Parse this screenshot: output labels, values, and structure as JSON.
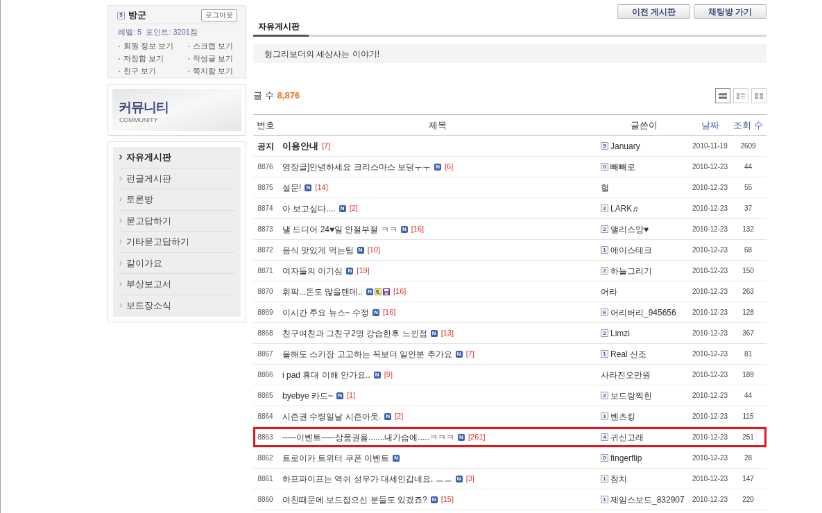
{
  "user_box": {
    "level": "5",
    "name": "방군",
    "logout_button": "로그아웃",
    "stats": "레벨: 5  포인트: 3201점",
    "links": [
      "회원 정보 보기",
      "스크랩 보기",
      "저장함 보기",
      "작성글 보기",
      "친구 보기",
      "쪽지함 보기"
    ]
  },
  "community_banner": {
    "title": "커뮤니티",
    "subtitle": "COMMUNITY"
  },
  "sidebar": {
    "items": [
      {
        "label": "자유게시판",
        "selected": true
      },
      {
        "label": "펀글게시판",
        "selected": false
      },
      {
        "label": "토론방",
        "selected": false
      },
      {
        "label": "묻고답하기",
        "selected": false
      },
      {
        "label": "기타묻고답하기",
        "selected": false
      },
      {
        "label": "같이가요",
        "selected": false
      },
      {
        "label": "부상보고서",
        "selected": false
      },
      {
        "label": "보드장소식",
        "selected": false
      }
    ]
  },
  "top_buttons": [
    "이전 게시판",
    "채팅방 가기"
  ],
  "tabs": [
    {
      "label": "자유게시판",
      "selected": true
    }
  ],
  "description": "헝그리보더의 세상사는 이야기!",
  "post_count": {
    "label": "글 수",
    "value": "8,876"
  },
  "view_modes": [
    {
      "kind": "list",
      "selected": true
    },
    {
      "kind": "summary",
      "selected": false
    },
    {
      "kind": "grid",
      "selected": false
    }
  ],
  "table": {
    "columns": [
      {
        "label": "번호",
        "sortable": false
      },
      {
        "label": "제목",
        "sortable": false
      },
      {
        "label": "글쓴이",
        "sortable": false
      },
      {
        "label": "날짜",
        "sortable": true
      },
      {
        "label": "조회 수",
        "sortable": true
      }
    ],
    "rows": [
      {
        "kind": "notice",
        "number": "공지",
        "subject": {
          "title": "이용안내",
          "comments": "[7]"
        },
        "writer": {
          "level": "5",
          "name": "January"
        },
        "date": "2010-11-19",
        "views": "2609",
        "highlighted": false
      },
      {
        "kind": "post",
        "number": "8876",
        "subject": {
          "title": "염장글]안녕하세요 크리스마스 보딩ㅜㅜ",
          "new_badge": "N",
          "comments": "[6]"
        },
        "writer": {
          "level": "0",
          "name": "빼빼로"
        },
        "date": "2010-12-23",
        "views": "44",
        "highlighted": false
      },
      {
        "kind": "post",
        "number": "8875",
        "subject": {
          "title": "설문!",
          "new_badge": "N",
          "comments": "[14]"
        },
        "writer": {
          "name": "헐"
        },
        "date": "2010-12-23",
        "views": "55",
        "highlighted": false
      },
      {
        "kind": "post",
        "number": "8874",
        "subject": {
          "title": "아 보고싶다....",
          "new_badge": "N",
          "comments": "[2]"
        },
        "writer": {
          "level": "2",
          "name": "LARK♬"
        },
        "date": "2010-12-23",
        "views": "37",
        "highlighted": false
      },
      {
        "kind": "post",
        "number": "8873",
        "subject": {
          "title": "낼 드디어 24♥일 안절부절 ㅋㅋ",
          "new_badge": "N",
          "comments": "[16]"
        },
        "writer": {
          "level": "2",
          "name": "앨리스양♥"
        },
        "date": "2010-12-23",
        "views": "132",
        "highlighted": false
      },
      {
        "kind": "post",
        "number": "8872",
        "subject": {
          "title": "음식 맛있게 먹는팁",
          "new_badge": "N",
          "comments": "[10]"
        },
        "writer": {
          "level": "1",
          "name": "에이스테크"
        },
        "date": "2010-12-23",
        "views": "68",
        "highlighted": false
      },
      {
        "kind": "post",
        "number": "8871",
        "subject": {
          "title": "여자들의 이기심",
          "new_badge": "N",
          "comments": "[19]"
        },
        "writer": {
          "level": "2",
          "name": "하늘그리기"
        },
        "date": "2010-12-23",
        "views": "150",
        "highlighted": false
      },
      {
        "kind": "post",
        "number": "8870",
        "subject": {
          "title": "휘팍...돈도 많을텐데..",
          "new_badge": "N",
          "attachments": [
            {
              "kind": "image"
            },
            {
              "kind": "disk"
            }
          ],
          "comments": "[16]"
        },
        "writer": {
          "name": "어라"
        },
        "date": "2010-12-23",
        "views": "263",
        "highlighted": false
      },
      {
        "kind": "post",
        "number": "8869",
        "subject": {
          "title": "이시간 주요 뉴스~ 수정",
          "new_badge": "N",
          "comments": "[16]"
        },
        "writer": {
          "level": "6",
          "name": "어리버리_945656"
        },
        "date": "2010-12-23",
        "views": "128",
        "highlighted": false
      },
      {
        "kind": "post",
        "number": "8868",
        "subject": {
          "title": "친구여친과 그친구2명 강습한후 느낀점",
          "new_badge": "N",
          "comments": "[13]"
        },
        "writer": {
          "level": "2",
          "name": "Limzi"
        },
        "date": "2010-12-23",
        "views": "367",
        "highlighted": false
      },
      {
        "kind": "post",
        "number": "8867",
        "subject": {
          "title": "올해도 스키장 고고하는 꼭보더 일인분 추가요",
          "new_badge": "N",
          "comments": "[7]"
        },
        "writer": {
          "level": "1",
          "name": "Real 신조"
        },
        "date": "2010-12-23",
        "views": "81",
        "highlighted": false
      },
      {
        "kind": "post",
        "number": "8866",
        "subject": {
          "title": "i pad 휴대 이해 안가요..",
          "new_badge": "N",
          "comments": "[9]"
        },
        "writer": {
          "name": "사라진오만원"
        },
        "date": "2010-12-23",
        "views": "189",
        "highlighted": false
      },
      {
        "kind": "post",
        "number": "8865",
        "subject": {
          "title": "byebye 카드~",
          "new_badge": "N",
          "comments": "[1]"
        },
        "writer": {
          "level": "2",
          "name": "보드랑찍힌"
        },
        "date": "2010-12-23",
        "views": "44",
        "highlighted": false
      },
      {
        "kind": "post",
        "number": "8864",
        "subject": {
          "title": "시즌권 수령일날 시즌아웃.",
          "new_badge": "N",
          "comments": "[2]"
        },
        "writer": {
          "level": "1",
          "name": "벤츠킹"
        },
        "date": "2010-12-23",
        "views": "115",
        "highlighted": false
      },
      {
        "kind": "post",
        "number": "8863",
        "subject": {
          "title": "-----이벤트-----상품권을.......내가슴에.....ㅋㅋㅋ",
          "new_badge": "N",
          "comments": "[261]"
        },
        "writer": {
          "level": "4",
          "name": "귀신고래"
        },
        "date": "2010-12-23",
        "views": "251",
        "highlighted": true
      },
      {
        "kind": "post",
        "number": "8862",
        "subject": {
          "title": "트로이카 트위터 쿠폰 이벤트",
          "new_badge": "N"
        },
        "writer": {
          "level": "0",
          "name": "fingerflip"
        },
        "date": "2010-12-23",
        "views": "28",
        "highlighted": false
      },
      {
        "kind": "post",
        "number": "8861",
        "subject": {
          "title": "하프파이프는 역쉬 성우가 대세인갑네요. ㅡㅡ",
          "new_badge": "N",
          "comments": "[3]"
        },
        "writer": {
          "level": "1",
          "name": "참치"
        },
        "date": "2010-12-23",
        "views": "147",
        "highlighted": false
      },
      {
        "kind": "post",
        "number": "8860",
        "subject": {
          "title": "여친때문에 보드접으신 분들도 있겠죠?",
          "new_badge": "N",
          "comments": "[15]"
        },
        "writer": {
          "level": "1",
          "name": "제임스보드_832907"
        },
        "date": "2010-12-23",
        "views": "220",
        "highlighted": false
      }
    ]
  }
}
